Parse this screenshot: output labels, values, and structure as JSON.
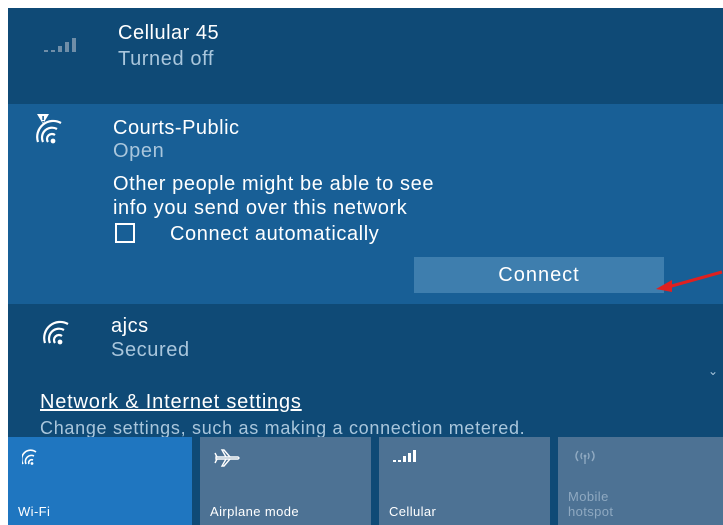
{
  "networks": {
    "cellular": {
      "name": "Cellular 45",
      "status": "Turned off"
    },
    "courts": {
      "name": "Courts-Public",
      "status": "Open",
      "warning_line1": "Other people might be able to see",
      "warning_line2": "info you send over this network",
      "auto_connect_label": "Connect automatically",
      "auto_connect_checked": false,
      "connect_label": "Connect"
    },
    "ajcs": {
      "name": "ajcs",
      "status": "Secured"
    }
  },
  "settings": {
    "link_label": "Network & Internet settings",
    "description": "Change settings, such as making a connection metered."
  },
  "quick_actions": [
    {
      "label": "Wi-Fi",
      "icon": "wifi-icon",
      "active": true
    },
    {
      "label": "Airplane mode",
      "icon": "airplane-icon",
      "active": false
    },
    {
      "label": "Cellular",
      "icon": "cellular-icon",
      "active": false
    },
    {
      "label": "Mobile hotspot",
      "icon": "hotspot-icon",
      "active": false,
      "disabled": true
    }
  ],
  "colors": {
    "panel_bg": "#0f4a76",
    "selected_bg": "#185f96",
    "button_bg": "#3e7eae",
    "tile_bg": "#4d7294",
    "tile_active_bg": "#1f76c0",
    "secondary_text": "#a9c6dc",
    "annotation_arrow": "#e02020"
  }
}
